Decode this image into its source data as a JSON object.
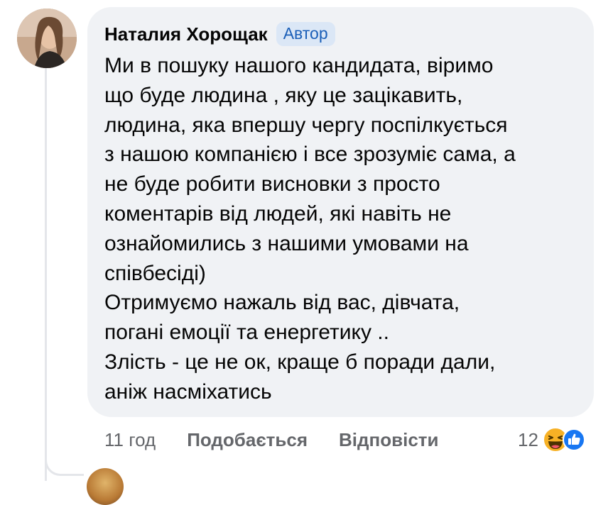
{
  "comment": {
    "author": "Наталия Хорощак",
    "badge": "Автор",
    "lines": [
      "Ми в пошуку нашого кандидата, віримо",
      "що буде людина , яку це зацікавить,",
      "людина, яка впершу чергу поспілкується",
      "з нашою компанією і все зрозуміє сама, а",
      "не буде робити висновки з просто",
      "коментарів від людей, які навіть не",
      "ознайомились з нашими умовами на",
      "співбесіді)",
      "Отримуємо нажаль від вас, дівчата,",
      "погані емоції та енергетику ..",
      "Злість - це не ок, краще б поради дали,",
      "аніж насміхатись"
    ],
    "time": "11 год",
    "like_label": "Подобається",
    "reply_label": "Відповісти",
    "reaction_count": "12",
    "reaction_icons": [
      "haha-emoji-icon",
      "like-thumb-icon"
    ]
  },
  "colors": {
    "bubble": "#f0f2f5",
    "badge_bg": "#dbe7f6",
    "badge_text": "#1b5fb8",
    "muted_text": "#65676b",
    "like_blue": "#1877f2"
  }
}
